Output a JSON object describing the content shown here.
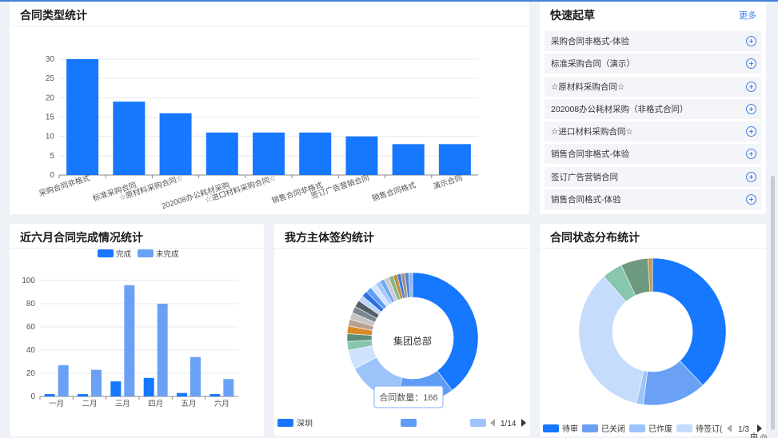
{
  "colors": {
    "primary": "#1677ff",
    "secondary": "#6aa1f5",
    "link": "#3f7ee8"
  },
  "type_chart": {
    "title": "合同类型统计",
    "chart_data": {
      "type": "bar",
      "categories": [
        "采购合同非格式",
        "标准采购合同",
        "☆原材料采购合同☆",
        "202008办公耗材采购",
        "☆进口材料采购合同☆",
        "销售合同非格式",
        "签订广告营销合同",
        "销售合同格式",
        "演示合同"
      ],
      "values": [
        30,
        19,
        16,
        11,
        11,
        11,
        10,
        8,
        8
      ],
      "yticks": [
        0,
        5,
        10,
        15,
        20,
        25,
        30
      ],
      "ylim": [
        0,
        30
      ],
      "xlabel": "",
      "ylabel": ""
    }
  },
  "quick": {
    "title": "快速起草",
    "more": "更多",
    "items": [
      {
        "label": "采购合同非格式-体验"
      },
      {
        "label": "标准采购合同（演示）"
      },
      {
        "label": "☆原材料采购合同☆"
      },
      {
        "label": "202008办公耗材采购（非格式合同）"
      },
      {
        "label": "☆进口材料采购合同☆"
      },
      {
        "label": "销售合同非格式-体验"
      },
      {
        "label": "签订广告营销合同"
      },
      {
        "label": "销售合同格式-体验"
      }
    ]
  },
  "six_month": {
    "title": "近六月合同完成情况统计",
    "chart_data": {
      "type": "bar",
      "categories": [
        "一月",
        "二月",
        "三月",
        "四月",
        "五月",
        "六月"
      ],
      "series": [
        {
          "name": "完成",
          "values": [
            2,
            2,
            13,
            16,
            3,
            2
          ],
          "color": "#1677ff"
        },
        {
          "name": "未完成",
          "values": [
            27,
            23,
            96,
            80,
            34,
            15
          ],
          "color": "#6aa1f5"
        }
      ],
      "yticks": [
        0,
        20,
        40,
        60,
        80,
        100
      ],
      "ylim": [
        0,
        100
      ],
      "legend": "top-center"
    }
  },
  "subject": {
    "title": "我方主体签约统计",
    "tooltip": "合同数量：166",
    "center_label": "集团总部",
    "page": "1/14",
    "legend_first": "深圳",
    "chart_data": {
      "type": "pie",
      "slices": [
        {
          "value": 166,
          "color": "#1677ff"
        },
        {
          "value": 60,
          "color": "#5f9cf6"
        },
        {
          "value": 55,
          "color": "#9dc3fb"
        },
        {
          "value": 20,
          "color": "#cfe2fd"
        },
        {
          "value": 9,
          "color": "#86c7ad"
        },
        {
          "value": 8,
          "color": "#5b8f76"
        },
        {
          "value": 8,
          "color": "#d88a2a"
        },
        {
          "value": 7,
          "color": "#b9a08d"
        },
        {
          "value": 7,
          "color": "#c5c5c5"
        },
        {
          "value": 7,
          "color": "#7c8791"
        },
        {
          "value": 7,
          "color": "#565e66"
        },
        {
          "value": 6,
          "color": "#bbd5fb"
        },
        {
          "value": 6,
          "color": "#2c6fdf"
        },
        {
          "value": 6,
          "color": "#5d9bf7"
        },
        {
          "value": 6,
          "color": "#d6e6fd"
        },
        {
          "value": 5,
          "color": "#a6c9fb"
        },
        {
          "value": 5,
          "color": "#73a9f7"
        },
        {
          "value": 5,
          "color": "#cccccc"
        },
        {
          "value": 5,
          "color": "#88b68d"
        },
        {
          "value": 4,
          "color": "#c48733"
        },
        {
          "value": 4,
          "color": "#3d7fe0"
        },
        {
          "value": 4,
          "color": "#a78f7e"
        },
        {
          "value": 4,
          "color": "#4f86d6"
        },
        {
          "value": 4,
          "color": "#8eb6f2"
        }
      ]
    }
  },
  "status": {
    "title": "合同状态分布统计",
    "page": "1/3",
    "legend": [
      "待审",
      "已关闭",
      "已作废",
      "待签订("
    ],
    "chart_data": {
      "type": "pie",
      "slices": [
        {
          "name": "待审",
          "value": 38,
          "color": "#1677ff"
        },
        {
          "name": "已关闭",
          "value": 14,
          "color": "#6aa1f5"
        },
        {
          "name": "已作废",
          "value": 1.5,
          "color": "#9dc3fb"
        },
        {
          "name": "待签订(",
          "value": 35,
          "color": "#c6dcfc"
        },
        {
          "value": 4.5,
          "color": "#86c7ad"
        },
        {
          "value": 6,
          "color": "#6e9a80"
        },
        {
          "value": 1,
          "color": "#c99a44"
        }
      ]
    }
  },
  "ime": "中 ◎"
}
